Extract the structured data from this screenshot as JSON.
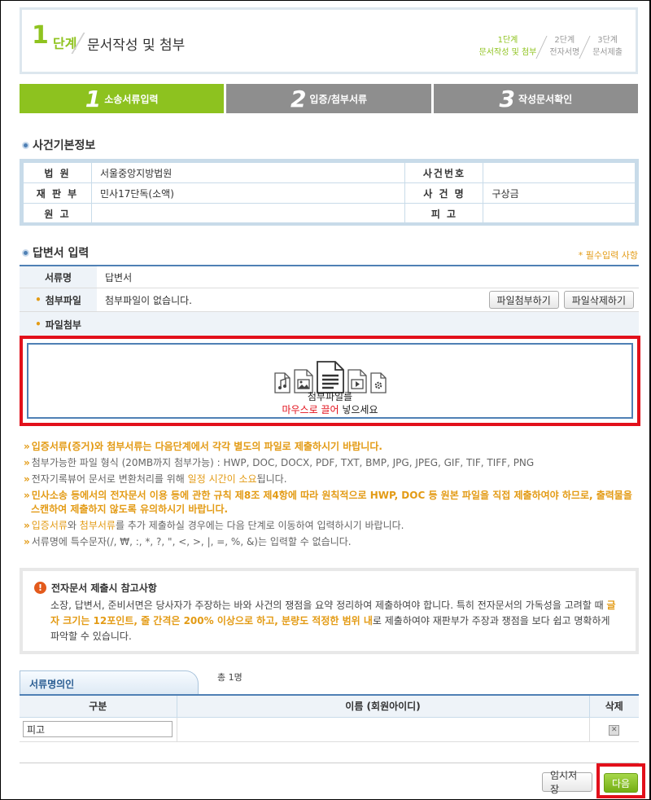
{
  "header": {
    "stage_num": "1",
    "stage_word": "단계",
    "title": "문서작성 및 첨부",
    "steps": [
      {
        "l1": "1단계",
        "l2": "문서작성 및 첨부"
      },
      {
        "l1": "2단계",
        "l2": "전자서명"
      },
      {
        "l1": "3단계",
        "l2": "문서제출"
      }
    ]
  },
  "tabs": [
    {
      "num": "1",
      "label": "소송서류입력"
    },
    {
      "num": "2",
      "label": "입증/첨부서류"
    },
    {
      "num": "3",
      "label": "작성문서확인"
    }
  ],
  "case_info": {
    "heading": "사건기본정보",
    "court_label": "법 원",
    "court_value": "서울중앙지방법원",
    "case_no_label": "사건번호",
    "case_no_value": "",
    "division_label": "재 판 부",
    "division_value": "민사17단독(소액)",
    "case_name_label": "사 건 명",
    "case_name_value": "구상금",
    "plaintiff_label": "원 고",
    "plaintiff_value": "",
    "defendant_label": "피 고",
    "defendant_value": ""
  },
  "answer": {
    "heading": "답변서 입력",
    "required_note": "* 필수입력 사항",
    "doc_name_label": "서류명",
    "doc_name_value": "답변서",
    "attach_label": "첨부파일",
    "attach_value": "첨부파일이 없습니다.",
    "attach_button": "파일첨부하기",
    "delete_button": "파일삭제하기",
    "file_attach_label": "파일첨부",
    "drop_line1": "첨부파일를",
    "drop_red": "마우스로 끌어",
    "drop_rest": " 넣으세요"
  },
  "notes": {
    "n1": "입증서류(증거)와 첨부서류는 다음단계에서 각각 별도의 파일로 제출하시기 바랍니다.",
    "n2": "첨부가능한 파일 형식 (20MB까지 첨부가능) : HWP, DOC, DOCX, PDF, TXT, BMP, JPG, JPEG, GIF, TIF, TIFF, PNG",
    "n3a": "전자기록뷰어 문서로 변환처리를 위해 ",
    "n3b": "일정 시간이 소요",
    "n3c": "됩니다.",
    "n4": "민사소송 등에서의 전자문서 이용 등에 관한 규칙 제8조 제4항에 따라 원칙적으로 HWP, DOC 등 원본 파일을 직접 제출하여야 하므로, 출력물을 스캔하여 제출하지 않도록 유의하시기 바랍니다.",
    "n5a": "입증서류",
    "n5b": "와 ",
    "n5c": "첨부서류",
    "n5d": "를 추가 제출하실 경우에는 다음 단계로 이동하여 입력하시기 바랍니다.",
    "n6": "서류명에 특수문자(/, ₩, :, *, ?, \", <, >, |, =, %, &)는 입력할 수 없습니다."
  },
  "reference": {
    "title": "전자문서 제출시 참고사항",
    "body_a": "소장, 답변서, 준비서면은 당사자가 주장하는 바와 사건의 쟁점을 요약 정리하여 제출하여야 합니다. 특히 전자문서의 가독성을 고려할 때 ",
    "body_hl": "글자 크기는 12포인트, 줄 간격은 200% 이상으로 하고, 분량도 적정한 범위 내",
    "body_b": "로 제출하여야 재판부가 주장과 쟁점을 보다 쉽고 명확하게 파악할 수 있습니다."
  },
  "signers": {
    "tab_label": "서류명의인",
    "count": "총 1명",
    "col_type": "구분",
    "col_name": "이름 (회원아이디)",
    "col_delete": "삭제",
    "rows": [
      {
        "type": "피고",
        "name": ""
      }
    ]
  },
  "footer": {
    "save_button": "임시저장",
    "next_button": "다음"
  },
  "colors": {
    "accent_green": "#8dc21f",
    "tab_gray": "#8e8e8e",
    "highlight_red": "#e2101b",
    "note_orange": "#e39b15",
    "border_blue": "#4f80b5"
  }
}
